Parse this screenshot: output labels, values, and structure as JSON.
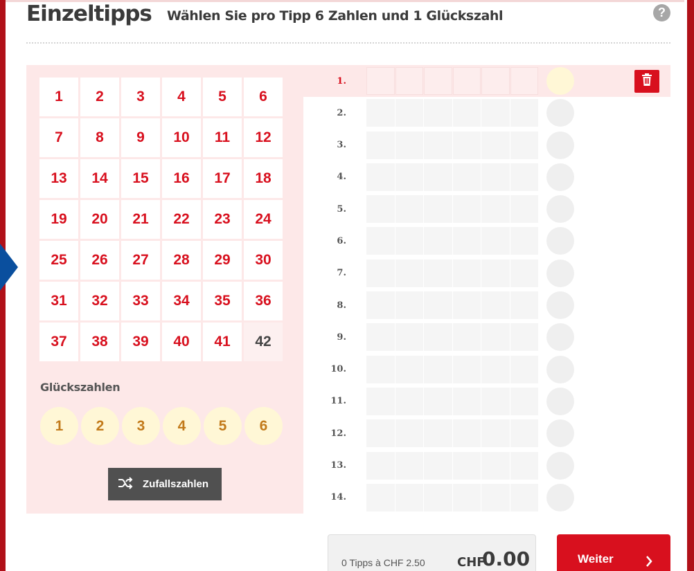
{
  "header": {
    "title": "Einzeltipps",
    "subtitle": "Wählen Sie pro Tipp 6 Zahlen und 1 Glückszahl",
    "help_icon": "?"
  },
  "number_grid": {
    "numbers": [
      "1",
      "2",
      "3",
      "4",
      "5",
      "6",
      "7",
      "8",
      "9",
      "10",
      "11",
      "12",
      "13",
      "14",
      "15",
      "16",
      "17",
      "18",
      "19",
      "20",
      "21",
      "22",
      "23",
      "24",
      "25",
      "26",
      "27",
      "28",
      "29",
      "30",
      "31",
      "32",
      "33",
      "34",
      "35",
      "36",
      "37",
      "38",
      "39",
      "40",
      "41",
      "42"
    ],
    "dimmed_number": "42"
  },
  "lucky": {
    "heading": "Glückszahlen",
    "numbers": [
      "1",
      "2",
      "3",
      "4",
      "5",
      "6"
    ]
  },
  "random_button": {
    "label": "Zufallszahlen",
    "icon": "shuffle-icon"
  },
  "tips": {
    "rows": [
      "1.",
      "2.",
      "3.",
      "4.",
      "5.",
      "6.",
      "7.",
      "8.",
      "9.",
      "10.",
      "11.",
      "12.",
      "13.",
      "14."
    ],
    "active_row": "1.",
    "delete_icon": "trash-icon"
  },
  "summary": {
    "count_label": "0 Tipps à CHF  2.50",
    "currency": "CHF",
    "total": "0.00"
  },
  "next_button": {
    "label": "Weiter",
    "icon": "chevron-right-icon"
  },
  "colors": {
    "accent_red": "#d8101e",
    "panel_pink": "#fde8e8",
    "lucky_yellow": "#fff7d6",
    "lucky_text": "#c27a1a",
    "side_blue": "#0a4f9e"
  }
}
